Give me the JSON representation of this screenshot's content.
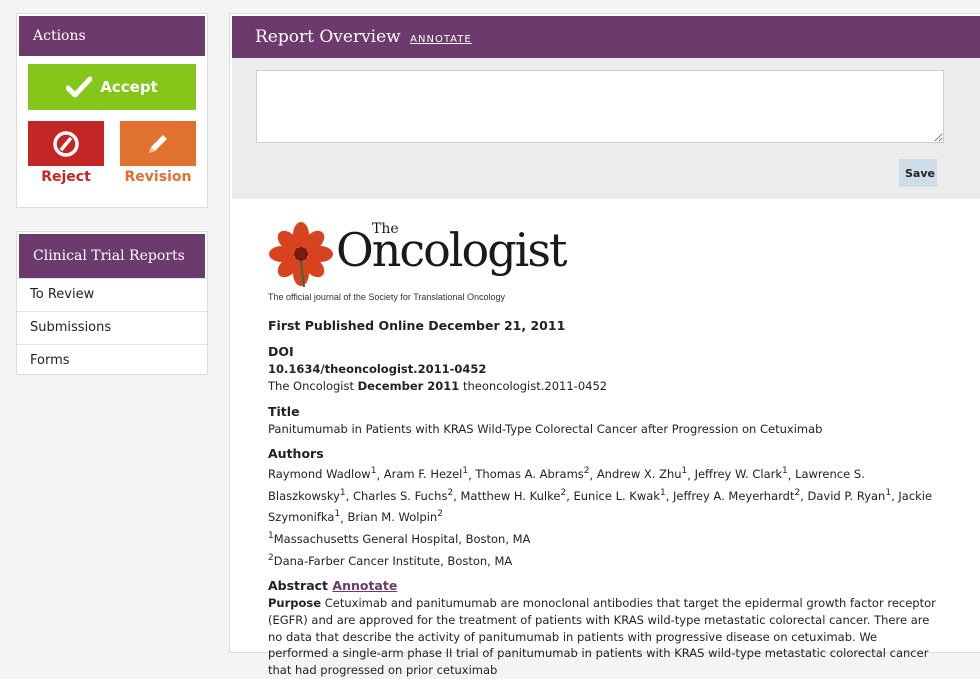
{
  "actions": {
    "title": "Actions",
    "accept_label": "Accept",
    "reject_label": "Reject",
    "revision_label": "Revision"
  },
  "clinical": {
    "title": "Clinical Trial Reports",
    "items": [
      {
        "label": "To Review"
      },
      {
        "label": "Submissions"
      },
      {
        "label": "Forms"
      }
    ]
  },
  "report": {
    "title": "Report Overview",
    "annotate_label": "ANNOTATE",
    "save_label": "Save"
  },
  "article": {
    "logo_the": "The",
    "logo_name": "Oncologist",
    "logo_tagline": "The official journal of the Society for Translational Oncology",
    "published": "First Published Online December 21, 2011",
    "doi_heading": "DOI",
    "doi": "10.1634/theoncologist.2011-0452",
    "citation_journal": "The Oncologist",
    "citation_date": "December 2011",
    "citation_id": "theoncologist.2011-0452",
    "title_heading": "Title",
    "title": "Panitumumab in Patients with KRAS Wild-Type Colorectal Cancer after Progression on Cetuximab",
    "authors_heading": "Authors",
    "authors": [
      {
        "name": "Raymond Wadlow",
        "aff": "1"
      },
      {
        "name": "Aram F. Hezel",
        "aff": "1"
      },
      {
        "name": "Thomas A. Abrams",
        "aff": "2"
      },
      {
        "name": "Andrew X. Zhu",
        "aff": "1"
      },
      {
        "name": "Jeffrey W. Clark",
        "aff": "1"
      },
      {
        "name": "Lawrence S. Blaszkowsky",
        "aff": "1"
      },
      {
        "name": "Charles S. Fuchs",
        "aff": "2"
      },
      {
        "name": "Matthew H. Kulke",
        "aff": "2"
      },
      {
        "name": "Eunice L. Kwak",
        "aff": "1"
      },
      {
        "name": "Jeffrey A. Meyerhardt",
        "aff": "2"
      },
      {
        "name": "David P. Ryan",
        "aff": "1"
      },
      {
        "name": "Jackie Szymonifka",
        "aff": "1"
      },
      {
        "name": "Brian M. Wolpin",
        "aff": "2"
      }
    ],
    "affiliations": [
      {
        "num": "1",
        "text": "Massachusetts General Hospital, Boston, MA"
      },
      {
        "num": "2",
        "text": "Dana-Farber Cancer Institute, Boston, MA"
      }
    ],
    "abstract_heading": "Abstract",
    "abstract_annotate": "Annotate",
    "purpose_label": "Purpose",
    "purpose_text": "Cetuximab and panitumumab are monoclonal antibodies that target the epidermal growth factor receptor (EGFR) and are approved for the treatment of patients with KRAS wild-type metastatic colorectal cancer. There are no data that describe the activity of panitumumab in patients with progressive disease on cetuximab. We performed a single-arm phase II trial of panitumumab in patients with KRAS wild-type metastatic colorectal cancer that had progressed on prior cetuximab"
  },
  "colors": {
    "header_purple": "#6c3a6c",
    "accept_green": "#84c61a",
    "reject_red": "#c42525",
    "revision_orange": "#e0712e"
  }
}
